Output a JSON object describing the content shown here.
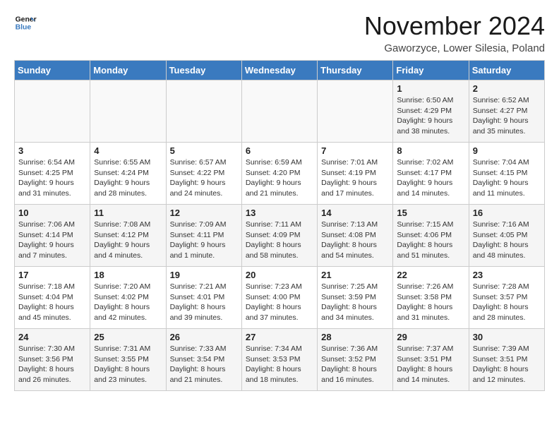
{
  "logo": {
    "line1": "General",
    "line2": "Blue"
  },
  "title": "November 2024",
  "location": "Gaworzyce, Lower Silesia, Poland",
  "weekdays": [
    "Sunday",
    "Monday",
    "Tuesday",
    "Wednesday",
    "Thursday",
    "Friday",
    "Saturday"
  ],
  "weeks": [
    [
      {
        "day": "",
        "info": ""
      },
      {
        "day": "",
        "info": ""
      },
      {
        "day": "",
        "info": ""
      },
      {
        "day": "",
        "info": ""
      },
      {
        "day": "",
        "info": ""
      },
      {
        "day": "1",
        "info": "Sunrise: 6:50 AM\nSunset: 4:29 PM\nDaylight: 9 hours and 38 minutes."
      },
      {
        "day": "2",
        "info": "Sunrise: 6:52 AM\nSunset: 4:27 PM\nDaylight: 9 hours and 35 minutes."
      }
    ],
    [
      {
        "day": "3",
        "info": "Sunrise: 6:54 AM\nSunset: 4:25 PM\nDaylight: 9 hours and 31 minutes."
      },
      {
        "day": "4",
        "info": "Sunrise: 6:55 AM\nSunset: 4:24 PM\nDaylight: 9 hours and 28 minutes."
      },
      {
        "day": "5",
        "info": "Sunrise: 6:57 AM\nSunset: 4:22 PM\nDaylight: 9 hours and 24 minutes."
      },
      {
        "day": "6",
        "info": "Sunrise: 6:59 AM\nSunset: 4:20 PM\nDaylight: 9 hours and 21 minutes."
      },
      {
        "day": "7",
        "info": "Sunrise: 7:01 AM\nSunset: 4:19 PM\nDaylight: 9 hours and 17 minutes."
      },
      {
        "day": "8",
        "info": "Sunrise: 7:02 AM\nSunset: 4:17 PM\nDaylight: 9 hours and 14 minutes."
      },
      {
        "day": "9",
        "info": "Sunrise: 7:04 AM\nSunset: 4:15 PM\nDaylight: 9 hours and 11 minutes."
      }
    ],
    [
      {
        "day": "10",
        "info": "Sunrise: 7:06 AM\nSunset: 4:14 PM\nDaylight: 9 hours and 7 minutes."
      },
      {
        "day": "11",
        "info": "Sunrise: 7:08 AM\nSunset: 4:12 PM\nDaylight: 9 hours and 4 minutes."
      },
      {
        "day": "12",
        "info": "Sunrise: 7:09 AM\nSunset: 4:11 PM\nDaylight: 9 hours and 1 minute."
      },
      {
        "day": "13",
        "info": "Sunrise: 7:11 AM\nSunset: 4:09 PM\nDaylight: 8 hours and 58 minutes."
      },
      {
        "day": "14",
        "info": "Sunrise: 7:13 AM\nSunset: 4:08 PM\nDaylight: 8 hours and 54 minutes."
      },
      {
        "day": "15",
        "info": "Sunrise: 7:15 AM\nSunset: 4:06 PM\nDaylight: 8 hours and 51 minutes."
      },
      {
        "day": "16",
        "info": "Sunrise: 7:16 AM\nSunset: 4:05 PM\nDaylight: 8 hours and 48 minutes."
      }
    ],
    [
      {
        "day": "17",
        "info": "Sunrise: 7:18 AM\nSunset: 4:04 PM\nDaylight: 8 hours and 45 minutes."
      },
      {
        "day": "18",
        "info": "Sunrise: 7:20 AM\nSunset: 4:02 PM\nDaylight: 8 hours and 42 minutes."
      },
      {
        "day": "19",
        "info": "Sunrise: 7:21 AM\nSunset: 4:01 PM\nDaylight: 8 hours and 39 minutes."
      },
      {
        "day": "20",
        "info": "Sunrise: 7:23 AM\nSunset: 4:00 PM\nDaylight: 8 hours and 37 minutes."
      },
      {
        "day": "21",
        "info": "Sunrise: 7:25 AM\nSunset: 3:59 PM\nDaylight: 8 hours and 34 minutes."
      },
      {
        "day": "22",
        "info": "Sunrise: 7:26 AM\nSunset: 3:58 PM\nDaylight: 8 hours and 31 minutes."
      },
      {
        "day": "23",
        "info": "Sunrise: 7:28 AM\nSunset: 3:57 PM\nDaylight: 8 hours and 28 minutes."
      }
    ],
    [
      {
        "day": "24",
        "info": "Sunrise: 7:30 AM\nSunset: 3:56 PM\nDaylight: 8 hours and 26 minutes."
      },
      {
        "day": "25",
        "info": "Sunrise: 7:31 AM\nSunset: 3:55 PM\nDaylight: 8 hours and 23 minutes."
      },
      {
        "day": "26",
        "info": "Sunrise: 7:33 AM\nSunset: 3:54 PM\nDaylight: 8 hours and 21 minutes."
      },
      {
        "day": "27",
        "info": "Sunrise: 7:34 AM\nSunset: 3:53 PM\nDaylight: 8 hours and 18 minutes."
      },
      {
        "day": "28",
        "info": "Sunrise: 7:36 AM\nSunset: 3:52 PM\nDaylight: 8 hours and 16 minutes."
      },
      {
        "day": "29",
        "info": "Sunrise: 7:37 AM\nSunset: 3:51 PM\nDaylight: 8 hours and 14 minutes."
      },
      {
        "day": "30",
        "info": "Sunrise: 7:39 AM\nSunset: 3:51 PM\nDaylight: 8 hours and 12 minutes."
      }
    ]
  ]
}
